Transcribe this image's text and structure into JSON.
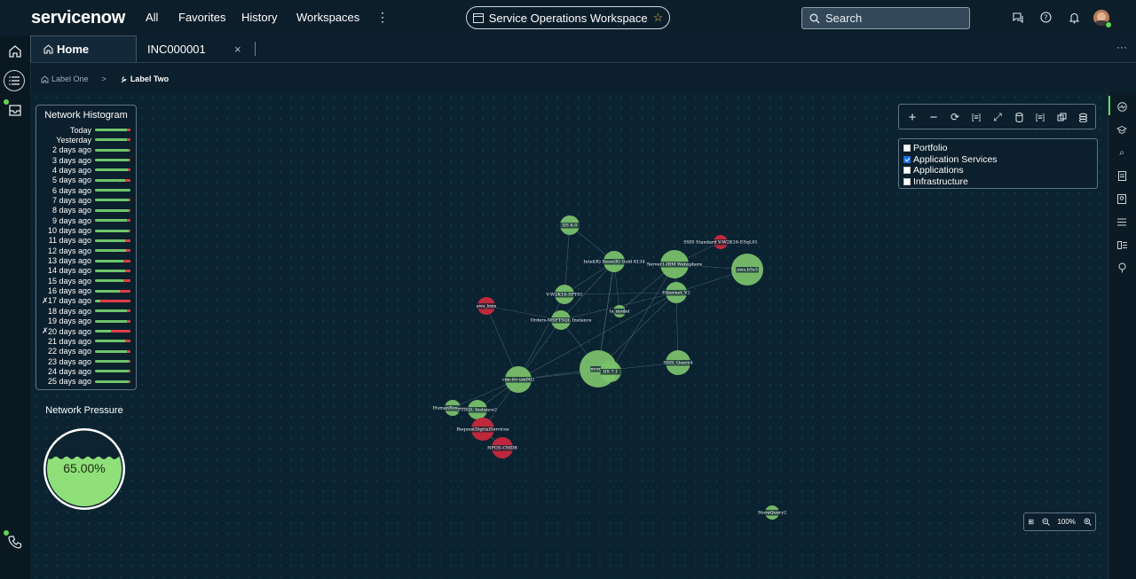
{
  "header": {
    "logo": "servicenow",
    "nav": [
      "All",
      "Favorites",
      "History",
      "Workspaces"
    ],
    "more_glyph": "⋮",
    "workspace_title": "Service Operations Workspace",
    "search_placeholder": "Search"
  },
  "tabs": [
    {
      "label": "Home",
      "active": true
    },
    {
      "label": "INC000001",
      "active": false,
      "close": "×"
    }
  ],
  "breadcrumb": {
    "first": "Label One",
    "separator": ">",
    "second": "Label Two"
  },
  "histogram": {
    "title": "Network Histogram",
    "rows": [
      {
        "label": "Today",
        "red": 0.1,
        "pinned": false
      },
      {
        "label": "Yesterday",
        "red": 0.1,
        "pinned": false
      },
      {
        "label": "2 days ago",
        "red": 0.05,
        "pinned": false
      },
      {
        "label": "3 days ago",
        "red": 0.05,
        "pinned": false
      },
      {
        "label": "4 days ago",
        "red": 0.08,
        "pinned": false
      },
      {
        "label": "5 days ago",
        "red": 0.15,
        "pinned": false
      },
      {
        "label": "6 days ago",
        "red": 0.0,
        "pinned": false
      },
      {
        "label": "7 days ago",
        "red": 0.05,
        "pinned": false
      },
      {
        "label": "8 days ago",
        "red": 0.05,
        "pinned": false
      },
      {
        "label": "9 days ago",
        "red": 0.1,
        "pinned": false
      },
      {
        "label": "10 days ago",
        "red": 0.05,
        "pinned": false
      },
      {
        "label": "11 days ago",
        "red": 0.15,
        "pinned": false
      },
      {
        "label": "12 days ago",
        "red": 0.12,
        "pinned": false
      },
      {
        "label": "13 days ago",
        "red": 0.2,
        "pinned": false
      },
      {
        "label": "14 days ago",
        "red": 0.15,
        "pinned": false
      },
      {
        "label": "15 days ago",
        "red": 0.2,
        "pinned": false
      },
      {
        "label": "16 days ago",
        "red": 0.3,
        "pinned": false
      },
      {
        "label": "17 days ago",
        "red": 0.85,
        "pinned": true
      },
      {
        "label": "18 days ago",
        "red": 0.1,
        "pinned": false
      },
      {
        "label": "19 days ago",
        "red": 0.1,
        "pinned": false
      },
      {
        "label": "20 days ago",
        "red": 0.55,
        "pinned": true
      },
      {
        "label": "21 days ago",
        "red": 0.15,
        "pinned": false
      },
      {
        "label": "22 days ago",
        "red": 0.1,
        "pinned": false
      },
      {
        "label": "23 days ago",
        "red": 0.05,
        "pinned": false
      },
      {
        "label": "24 days ago",
        "red": 0.05,
        "pinned": false
      },
      {
        "label": "25 days ago",
        "red": 0.05,
        "pinned": false
      }
    ]
  },
  "pressure": {
    "title": "Network Pressure",
    "value": "65.00%",
    "level": 0.65
  },
  "filters": [
    {
      "label": "Portfolio",
      "checked": false
    },
    {
      "label": "Application Services",
      "checked": true
    },
    {
      "label": "Applications",
      "checked": false
    },
    {
      "label": "Infrastructure",
      "checked": false
    }
  ],
  "zoom": {
    "value": "100%"
  },
  "graph": {
    "nodes": [
      {
        "label": "IIS 6.0",
        "status": "ok"
      },
      {
        "label": "SSIS Standard V-W2K16-ESqL01",
        "status": "crit"
      },
      {
        "label": "Intel(R) Xeon(R) Gold 6134",
        "status": "ok"
      },
      {
        "label": "Server1-IBM Websphere",
        "status": "ok"
      },
      {
        "label": "aws.b5s3",
        "status": "ok"
      },
      {
        "label": "V-W2K16-SPT01",
        "status": "ok"
      },
      {
        "label": "Ethernet_V2",
        "status": "ok"
      },
      {
        "label": "aws_kms",
        "status": "crit"
      },
      {
        "label": "Orders-MSFTSQL Instance",
        "status": "ok"
      },
      {
        "label": "ts_model",
        "status": "ok"
      },
      {
        "label": "mongo",
        "status": "ok"
      },
      {
        "label": "IIS 7.1",
        "status": "ok"
      },
      {
        "label": "SSIS_Query4",
        "status": "ok"
      },
      {
        "label": "cim-itv-um002",
        "status": "ok"
      },
      {
        "label": "HumanResources",
        "status": "ok"
      },
      {
        "label": "FTSQL Instance2",
        "status": "ok"
      },
      {
        "label": "RequestDigitalServices",
        "status": "crit"
      },
      {
        "label": "NPGS-CMDB",
        "status": "crit"
      },
      {
        "label": "StoreQuery2",
        "status": "ok"
      }
    ]
  },
  "colors": {
    "ok": "#7dc36c",
    "crit": "#c8293d",
    "bg": "#0b2331",
    "accent": "#62d84e"
  }
}
